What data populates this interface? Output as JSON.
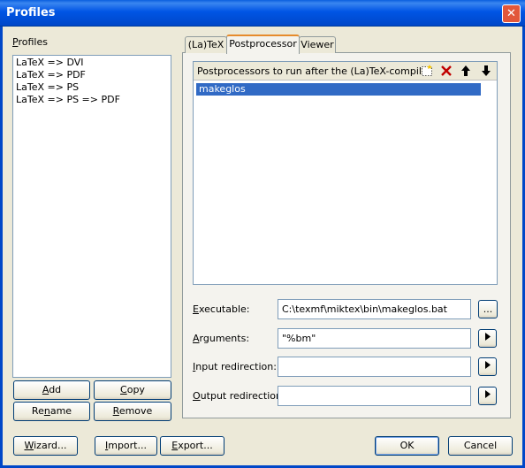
{
  "window": {
    "title": "Profiles",
    "close_symbol": "✕"
  },
  "profiles": {
    "label_accel": "P",
    "label_rest": "rofiles",
    "items": [
      "LaTeX => DVI",
      "LaTeX => PDF",
      "LaTeX => PS",
      "LaTeX => PS => PDF"
    ],
    "buttons": {
      "add": {
        "accel": "A",
        "rest": "dd"
      },
      "copy": {
        "accel": "C",
        "rest": "opy"
      },
      "rename": {
        "pre": "Re",
        "accel": "n",
        "rest": "ame"
      },
      "remove": {
        "accel": "R",
        "rest": "emove"
      }
    }
  },
  "tabs": [
    {
      "label": "(La)TeX",
      "active": false
    },
    {
      "label": "Postprocessor",
      "active": true
    },
    {
      "label": "Viewer",
      "active": false
    }
  ],
  "postprocessor": {
    "header": "Postprocessors to run after the (La)TeX-compiler",
    "items": [
      "makeglos"
    ],
    "fields": {
      "executable": {
        "accel": "E",
        "rest": "xecutable:",
        "value": "C:\\texmf\\miktex\\bin\\makeglos.bat",
        "button": "..."
      },
      "arguments": {
        "accel": "A",
        "rest": "rguments:",
        "value": "\"%bm\""
      },
      "input": {
        "accel": "I",
        "rest": "nput redirection:",
        "value": ""
      },
      "output": {
        "accel": "O",
        "rest": "utput redirection:",
        "value": ""
      }
    }
  },
  "footer": {
    "wizard": {
      "accel": "W",
      "rest": "izard..."
    },
    "import": {
      "accel": "I",
      "rest": "mport..."
    },
    "export": {
      "accel": "E",
      "rest": "xport..."
    },
    "ok": "OK",
    "cancel": "Cancel"
  }
}
